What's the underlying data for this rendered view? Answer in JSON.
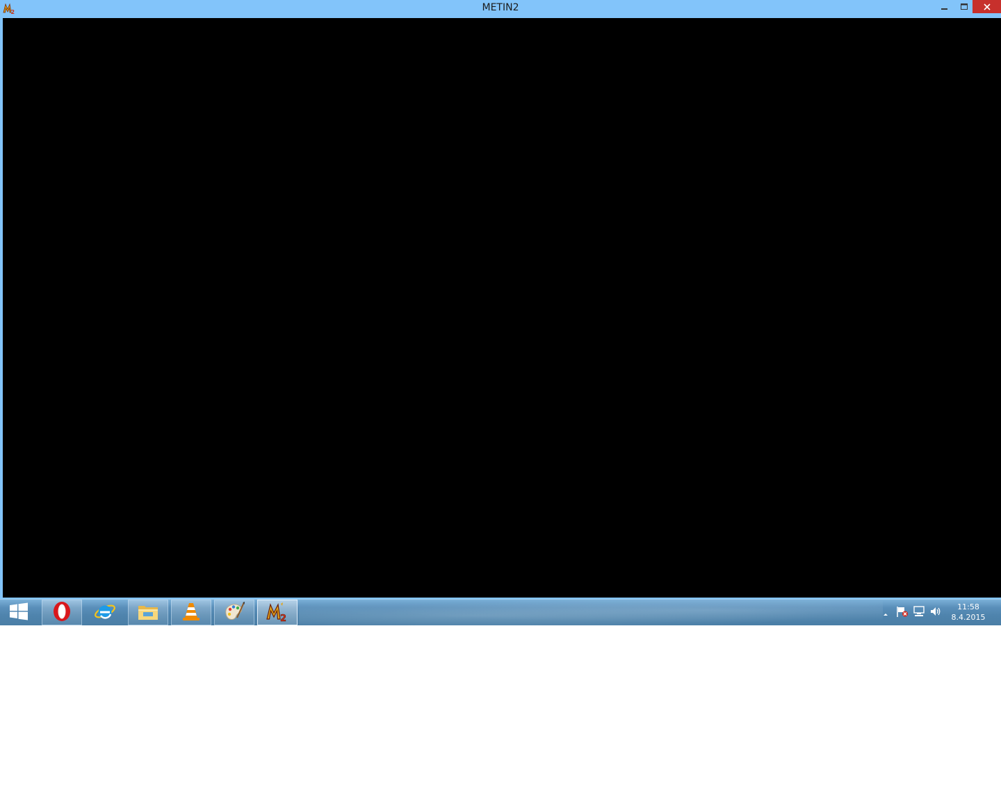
{
  "window": {
    "title": "METIN2",
    "app_icon": "metin2-icon",
    "controls": {
      "minimize_icon": "minimize-icon",
      "maximize_icon": "maximize-icon",
      "close_icon": "close-icon"
    },
    "titlebar_color": "#82c4fa",
    "close_color": "#c7302c",
    "client_color": "#000000"
  },
  "taskbar": {
    "start_icon": "windows-logo-icon",
    "pinned": [
      {
        "name": "opera",
        "icon": "opera-icon",
        "state": "pinned-running"
      },
      {
        "name": "internet-explorer",
        "icon": "internet-explorer-icon",
        "state": "pinned"
      },
      {
        "name": "file-explorer",
        "icon": "folder-icon",
        "state": "pinned-running"
      },
      {
        "name": "vlc",
        "icon": "vlc-cone-icon",
        "state": "pinned-running"
      },
      {
        "name": "paint",
        "icon": "paint-palette-icon",
        "state": "pinned-running"
      },
      {
        "name": "metin2",
        "icon": "metin2-icon",
        "state": "active"
      }
    ],
    "tray": {
      "icons": [
        "show-hidden-icons-chevron",
        "action-center-flag-icon",
        "network-icon",
        "volume-icon"
      ],
      "clock": {
        "time": "11:58",
        "date": "8.4.2015"
      }
    }
  }
}
